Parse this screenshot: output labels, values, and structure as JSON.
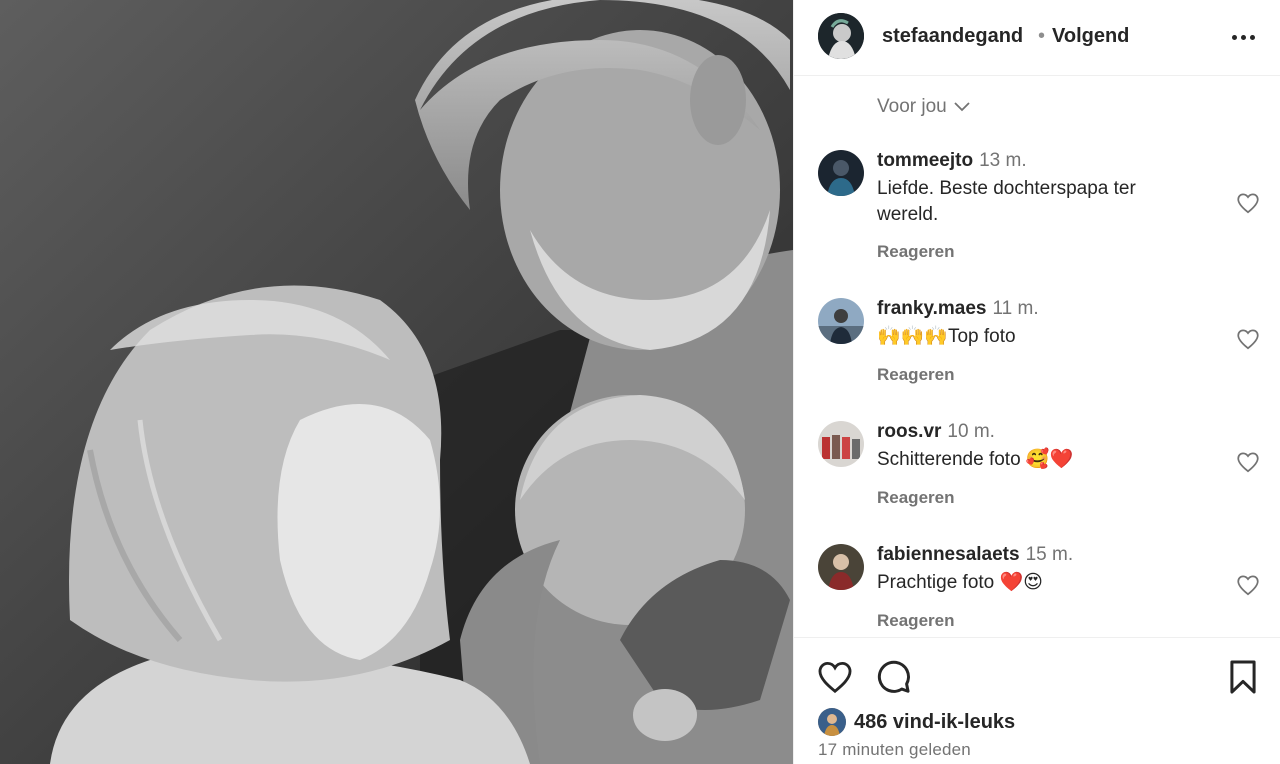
{
  "post": {
    "username": "stefaandegand",
    "separator": "•",
    "follow_status": "Volgend",
    "sort_label": "Voor jou",
    "likes_label": "486 vind-ik-leuks",
    "time_label": "17 minuten geleden"
  },
  "comments": [
    {
      "user": "tommeejto",
      "time": "13 m.",
      "text": "Liefde. Beste dochterspapa ter wereld.",
      "reply": "Reageren"
    },
    {
      "user": "franky.maes",
      "time": "11 m.",
      "text": "🙌🙌🙌Top foto",
      "reply": "Reageren"
    },
    {
      "user": "roos.vr",
      "time": "10 m.",
      "text": "Schitterende foto 🥰❤️",
      "reply": "Reageren"
    },
    {
      "user": "fabiennesalaets",
      "time": "15 m.",
      "text": "Prachtige foto ❤️😍",
      "reply": "Reageren"
    }
  ],
  "icons": {
    "more": "more-options-icon",
    "sort": "chevron-down-icon",
    "like": "heart-icon",
    "comment": "comment-icon",
    "save": "bookmark-icon"
  },
  "colors": {
    "text": "#262626",
    "secondary": "#737373",
    "border": "#efefef"
  }
}
